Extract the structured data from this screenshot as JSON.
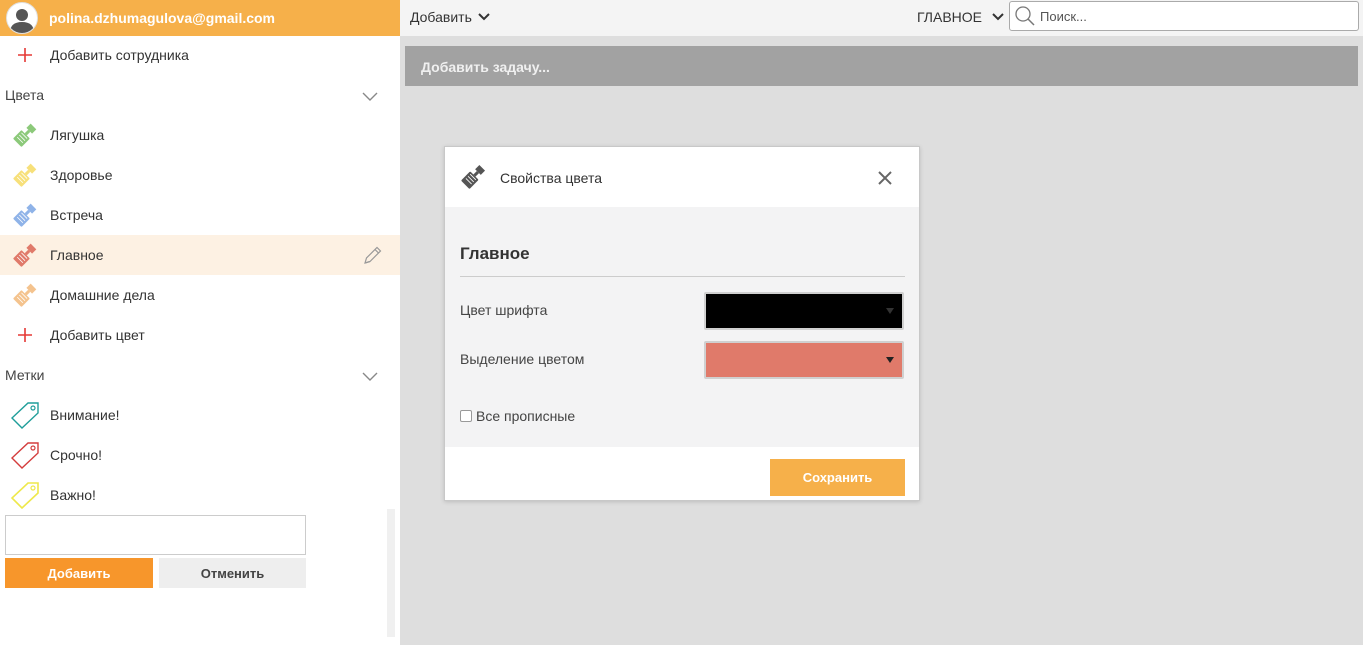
{
  "user": {
    "email": "polina.dzhumagulova@gmail.com"
  },
  "sidebar": {
    "add_employee": "Добавить сотрудника",
    "colors_section": "Цвета",
    "colors": [
      {
        "label": "Лягушка",
        "color": "#8cc97a"
      },
      {
        "label": "Здоровье",
        "color": "#f7e07a"
      },
      {
        "label": "Встреча",
        "color": "#8fb3e8"
      },
      {
        "label": "Главное",
        "color": "#e07a6a"
      },
      {
        "label": "Домашние дела",
        "color": "#f4c38e"
      }
    ],
    "add_color": "Добавить цвет",
    "labels_section": "Метки",
    "labels": [
      {
        "label": "Внимание!",
        "color": "#1f9e9a"
      },
      {
        "label": "Срочно!",
        "color": "#d43d3d"
      },
      {
        "label": "Важно!",
        "color": "#eee84a"
      }
    ],
    "add_button": "Добавить",
    "cancel_button": "Отменить"
  },
  "topbar": {
    "add_menu": "Добавить",
    "filter": "ГЛАВНОЕ",
    "search_placeholder": "Поиск..."
  },
  "main": {
    "add_task_placeholder": "Добавить задачу..."
  },
  "dialog": {
    "title": "Свойства цвета",
    "color_name": "Главное",
    "font_color_label": "Цвет шрифта",
    "font_color": "#000000",
    "highlight_label": "Выделение цветом",
    "highlight_color": "#e07a6a",
    "uppercase_label": "Все прописные",
    "uppercase_checked": false,
    "save_button": "Сохранить"
  },
  "colors": {
    "accent": "#f6b04a",
    "add_button": "#f7962b",
    "plus_icon": "#e53935",
    "active_row": "#fdf1e3"
  }
}
